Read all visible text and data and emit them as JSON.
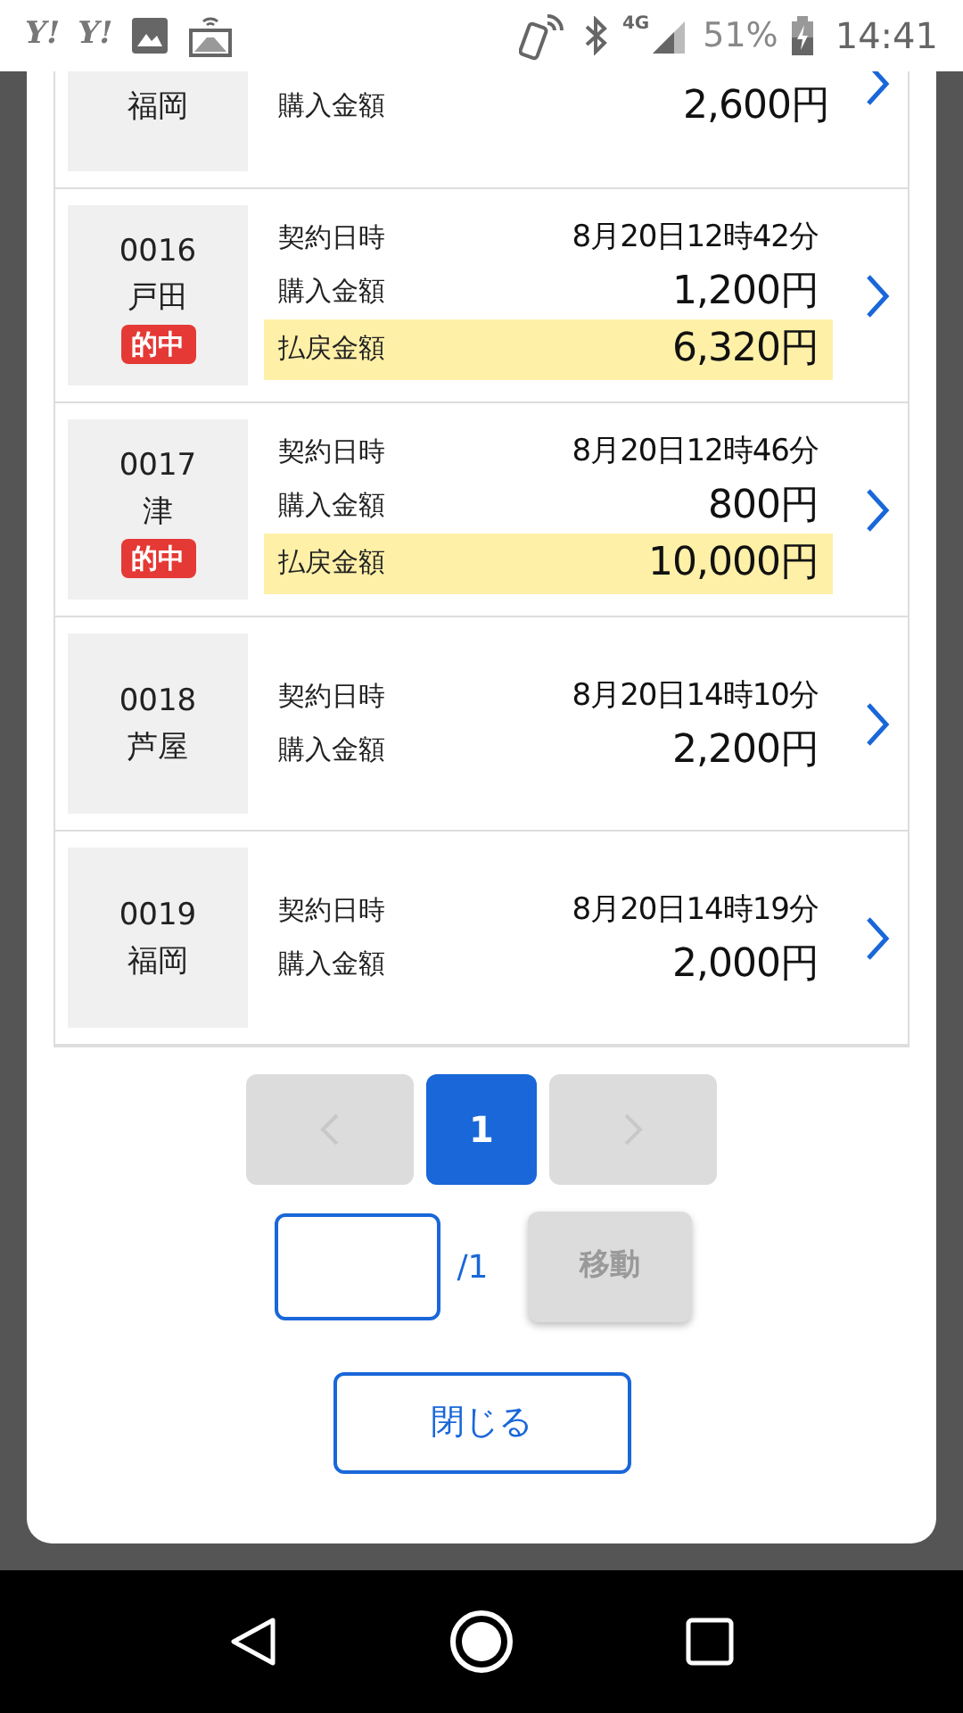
{
  "status_bar": {
    "notifications": [
      "Y!",
      "Y!"
    ],
    "network": "4G",
    "battery": "51%",
    "time": "14:41"
  },
  "contracts": [
    {
      "kind": "partial",
      "place": "福岡",
      "rows": [
        {
          "kind": "purchase",
          "label": "購入金額",
          "value": "2,600円"
        }
      ]
    },
    {
      "kind": "full",
      "number": "0016",
      "place": "戸田",
      "badge": "的中",
      "rows": [
        {
          "kind": "datetime",
          "label": "契約日時",
          "value": "8月20日12時42分"
        },
        {
          "kind": "purchase",
          "label": "購入金額",
          "value": "1,200円"
        },
        {
          "kind": "payout",
          "label": "払戻金額",
          "value": "6,320円"
        }
      ]
    },
    {
      "kind": "full",
      "number": "0017",
      "place": "津",
      "badge": "的中",
      "rows": [
        {
          "kind": "datetime",
          "label": "契約日時",
          "value": "8月20日12時46分"
        },
        {
          "kind": "purchase",
          "label": "購入金額",
          "value": "800円"
        },
        {
          "kind": "payout",
          "label": "払戻金額",
          "value": "10,000円"
        }
      ]
    },
    {
      "kind": "full",
      "number": "0018",
      "place": "芦屋",
      "rows": [
        {
          "kind": "datetime",
          "label": "契約日時",
          "value": "8月20日14時10分"
        },
        {
          "kind": "purchase",
          "label": "購入金額",
          "value": "2,200円"
        }
      ]
    },
    {
      "kind": "full",
      "number": "0019",
      "place": "福岡",
      "rows": [
        {
          "kind": "datetime",
          "label": "契約日時",
          "value": "8月20日14時19分"
        },
        {
          "kind": "purchase",
          "label": "購入金額",
          "value": "2,000円"
        }
      ]
    }
  ],
  "pagination": {
    "prev_disabled": true,
    "next_disabled": true,
    "pages": [
      {
        "label": "1",
        "selected": true
      }
    ]
  },
  "page_jump": {
    "total": "/1",
    "button": "移動",
    "disabled": true
  },
  "close_button": "閉じる"
}
